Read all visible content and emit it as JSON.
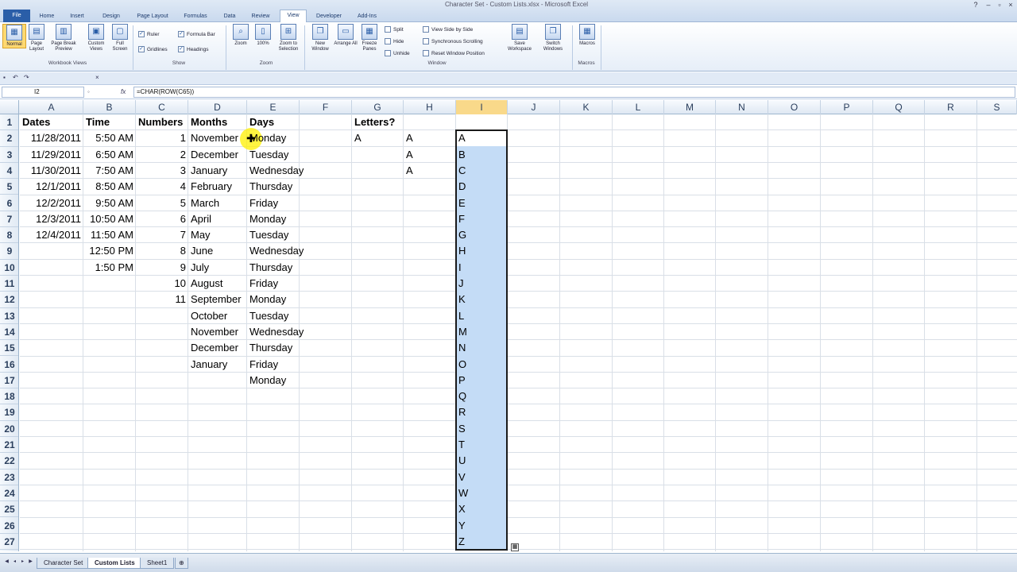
{
  "window": {
    "title": "Character Set - Custom Lists.xlsx - Microsoft Excel"
  },
  "ribbon": {
    "file_tab": "File",
    "tabs": [
      "Home",
      "Insert",
      "Design",
      "Page Layout",
      "Formulas",
      "Data",
      "Review",
      "View",
      "Developer",
      "Add-Ins"
    ],
    "active_tab": "View",
    "workbook_views": {
      "label": "Workbook Views",
      "buttons": [
        "Normal",
        "Page Layout",
        "Page Break Preview",
        "Custom Views",
        "Full Screen"
      ]
    },
    "show": {
      "label": "Show",
      "ruler": "Ruler",
      "formula_bar": "Formula Bar",
      "gridlines": "Gridlines",
      "headings": "Headings"
    },
    "zoom": {
      "label": "Zoom",
      "buttons": [
        "Zoom",
        "100%",
        "Zoom to Selection"
      ]
    },
    "window_group": {
      "label": "Window",
      "buttons": [
        "New Window",
        "Arrange All",
        "Freeze Panes"
      ],
      "split": "Split",
      "hide": "Hide",
      "unhide": "Unhide",
      "side_by_side": "View Side by Side",
      "sync_scroll": "Synchronous Scrolling",
      "reset_pos": "Reset Window Position",
      "save_workspace": "Save Workspace",
      "switch_windows": "Switch Windows"
    },
    "macros": {
      "label": "Macros",
      "button": "Macros"
    }
  },
  "formula_bar": {
    "name_box": "I2",
    "formula": "=CHAR(ROW(C65))",
    "fx": "fx"
  },
  "columns": [
    "A",
    "B",
    "C",
    "D",
    "E",
    "F",
    "G",
    "H",
    "I",
    "J",
    "K",
    "L",
    "M",
    "N",
    "O",
    "P",
    "Q",
    "R",
    "S"
  ],
  "rows": [
    "1",
    "2",
    "3",
    "4",
    "5",
    "6",
    "7",
    "8",
    "9",
    "10",
    "11",
    "12",
    "13",
    "14",
    "15",
    "16",
    "17",
    "18",
    "19",
    "20",
    "21",
    "22",
    "23",
    "24",
    "25",
    "26",
    "27"
  ],
  "headers": {
    "A": "Dates",
    "B": "Time",
    "C": "Numbers",
    "D": "Months",
    "E": "Days",
    "G": "Letters?"
  },
  "dates": [
    "11/28/2011",
    "11/29/2011",
    "11/30/2011",
    "12/1/2011",
    "12/2/2011",
    "12/3/2011",
    "12/4/2011"
  ],
  "times": [
    "5:50 AM",
    "6:50 AM",
    "7:50 AM",
    "8:50 AM",
    "9:50 AM",
    "10:50 AM",
    "11:50 AM",
    "12:50 PM",
    "1:50 PM"
  ],
  "numbers": [
    "1",
    "2",
    "3",
    "4",
    "5",
    "6",
    "7",
    "8",
    "9",
    "10",
    "11"
  ],
  "months": [
    "November",
    "December",
    "January",
    "February",
    "March",
    "April",
    "May",
    "June",
    "July",
    "August",
    "September",
    "October",
    "November",
    "December",
    "January"
  ],
  "days": [
    "Monday",
    "Tuesday",
    "Wednesday",
    "Thursday",
    "Friday",
    "Monday",
    "Tuesday",
    "Wednesday",
    "Thursday",
    "Friday",
    "Monday",
    "Tuesday",
    "Wednesday",
    "Thursday",
    "Friday",
    "Monday"
  ],
  "col_g": [
    "A"
  ],
  "col_h": [
    "A",
    "A",
    "A"
  ],
  "letters": [
    "A",
    "B",
    "C",
    "D",
    "E",
    "F",
    "G",
    "H",
    "I",
    "J",
    "K",
    "L",
    "M",
    "N",
    "O",
    "P",
    "Q",
    "R",
    "S",
    "T",
    "U",
    "V",
    "W",
    "X",
    "Y",
    "Z"
  ],
  "sheet_tabs": [
    "Character Set",
    "Custom Lists",
    "Sheet1"
  ],
  "active_sheet": "Custom Lists",
  "colors": {
    "selection": "#c4dcf6",
    "highlight": "#ffeb00",
    "ribbon_accent": "#2a5ea8"
  }
}
